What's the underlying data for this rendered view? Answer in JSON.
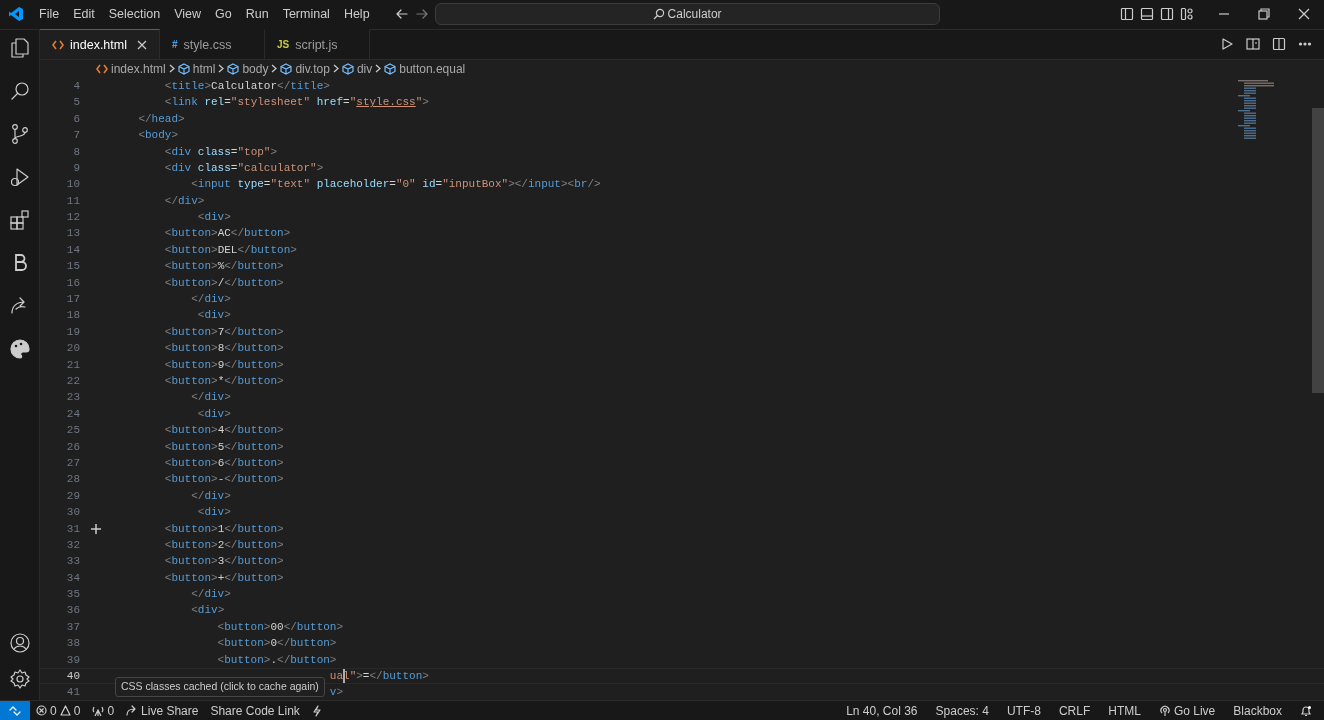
{
  "menu": [
    "File",
    "Edit",
    "Selection",
    "View",
    "Go",
    "Run",
    "Terminal",
    "Help"
  ],
  "command_center": {
    "text": "Calculator"
  },
  "tabs": [
    {
      "label": "index.html",
      "kind": "html",
      "selected": true
    },
    {
      "label": "style.css",
      "kind": "css",
      "badge": "#",
      "selected": false
    },
    {
      "label": "script.js",
      "kind": "js",
      "badge": "JS",
      "selected": false
    }
  ],
  "breadcrumbs": [
    {
      "label": "index.html",
      "kind": "file"
    },
    {
      "label": "html",
      "kind": "element"
    },
    {
      "label": "body",
      "kind": "element"
    },
    {
      "label": "div.top",
      "kind": "element"
    },
    {
      "label": "div",
      "kind": "element"
    },
    {
      "label": "button.equal",
      "kind": "element"
    }
  ],
  "code_lines": [
    {
      "number": "4",
      "current": false,
      "tokens": [
        {
          "kind": "punct",
          "text": "<"
        },
        {
          "kind": "tag",
          "text": "title"
        },
        {
          "kind": "punct",
          "text": ">"
        },
        {
          "kind": "text",
          "text": "Calculator"
        },
        {
          "kind": "punct",
          "text": "</"
        },
        {
          "kind": "tag",
          "text": "title"
        },
        {
          "kind": "punct",
          "text": ">"
        }
      ]
    },
    {
      "number": "5",
      "current": false,
      "tokens": [
        {
          "kind": "punct",
          "text": "<"
        },
        {
          "kind": "tag",
          "text": "link"
        },
        {
          "kind": "attr",
          "text": " rel"
        },
        {
          "kind": "text",
          "text": "="
        },
        {
          "kind": "string",
          "text": "\"stylesheet\""
        },
        {
          "kind": "attr",
          "text": " href"
        },
        {
          "kind": "text",
          "text": "="
        },
        {
          "kind": "string",
          "text": "\""
        },
        {
          "kind": "link",
          "text": "style.css"
        },
        {
          "kind": "string",
          "text": "\""
        },
        {
          "kind": "punct",
          "text": ">"
        }
      ]
    },
    {
      "number": "6",
      "current": false,
      "tokens": [
        {
          "kind": "punct",
          "text": "</"
        },
        {
          "kind": "tag",
          "text": "head"
        },
        {
          "kind": "punct",
          "text": ">"
        }
      ]
    },
    {
      "number": "7",
      "current": false,
      "tokens": [
        {
          "kind": "punct",
          "text": "<"
        },
        {
          "kind": "tag",
          "text": "body"
        },
        {
          "kind": "punct",
          "text": ">"
        }
      ]
    },
    {
      "number": "8",
      "current": false,
      "tokens": [
        {
          "kind": "punct",
          "text": "<"
        },
        {
          "kind": "tag",
          "text": "div"
        },
        {
          "kind": "attr",
          "text": " class"
        },
        {
          "kind": "text",
          "text": "="
        },
        {
          "kind": "string",
          "text": "\"top\""
        },
        {
          "kind": "punct",
          "text": ">"
        }
      ]
    },
    {
      "number": "9",
      "current": false,
      "tokens": [
        {
          "kind": "punct",
          "text": "<"
        },
        {
          "kind": "tag",
          "text": "div"
        },
        {
          "kind": "attr",
          "text": " class"
        },
        {
          "kind": "text",
          "text": "="
        },
        {
          "kind": "string",
          "text": "\"calculator\""
        },
        {
          "kind": "punct",
          "text": ">"
        }
      ]
    },
    {
      "number": "10",
      "current": false,
      "tokens": [
        {
          "kind": "punct",
          "text": "<"
        },
        {
          "kind": "tag",
          "text": "input"
        },
        {
          "kind": "attr",
          "text": " type"
        },
        {
          "kind": "text",
          "text": "="
        },
        {
          "kind": "string",
          "text": "\"text\""
        },
        {
          "kind": "attr",
          "text": " placeholder"
        },
        {
          "kind": "text",
          "text": "="
        },
        {
          "kind": "string",
          "text": "\"0\""
        },
        {
          "kind": "attr",
          "text": " id"
        },
        {
          "kind": "text",
          "text": "="
        },
        {
          "kind": "string",
          "text": "\"inputBox\""
        },
        {
          "kind": "punct",
          "text": "></"
        },
        {
          "kind": "tag",
          "text": "input"
        },
        {
          "kind": "punct",
          "text": "><"
        },
        {
          "kind": "tag",
          "text": "br"
        },
        {
          "kind": "punct",
          "text": "/>"
        }
      ]
    },
    {
      "number": "11",
      "current": false,
      "tokens": [
        {
          "kind": "punct",
          "text": "</"
        },
        {
          "kind": "tag",
          "text": "div"
        },
        {
          "kind": "punct",
          "text": ">"
        }
      ]
    },
    {
      "number": "12",
      "current": false,
      "tokens": [
        {
          "kind": "punct",
          "text": "<"
        },
        {
          "kind": "tag",
          "text": "div"
        },
        {
          "kind": "punct",
          "text": ">"
        }
      ]
    },
    {
      "number": "13",
      "current": false,
      "tokens": [
        {
          "kind": "punct",
          "text": "<"
        },
        {
          "kind": "tag",
          "text": "button"
        },
        {
          "kind": "punct",
          "text": ">"
        },
        {
          "kind": "text",
          "text": "AC"
        },
        {
          "kind": "punct",
          "text": "</"
        },
        {
          "kind": "tag",
          "text": "button"
        },
        {
          "kind": "punct",
          "text": ">"
        }
      ]
    },
    {
      "number": "14",
      "current": false,
      "tokens": [
        {
          "kind": "punct",
          "text": "<"
        },
        {
          "kind": "tag",
          "text": "button"
        },
        {
          "kind": "punct",
          "text": ">"
        },
        {
          "kind": "text",
          "text": "DEL"
        },
        {
          "kind": "punct",
          "text": "</"
        },
        {
          "kind": "tag",
          "text": "button"
        },
        {
          "kind": "punct",
          "text": ">"
        }
      ]
    },
    {
      "number": "15",
      "current": false,
      "tokens": [
        {
          "kind": "punct",
          "text": "<"
        },
        {
          "kind": "tag",
          "text": "button"
        },
        {
          "kind": "punct",
          "text": ">"
        },
        {
          "kind": "text",
          "text": "%"
        },
        {
          "kind": "punct",
          "text": "</"
        },
        {
          "kind": "tag",
          "text": "button"
        },
        {
          "kind": "punct",
          "text": ">"
        }
      ]
    },
    {
      "number": "16",
      "current": false,
      "tokens": [
        {
          "kind": "punct",
          "text": "<"
        },
        {
          "kind": "tag",
          "text": "button"
        },
        {
          "kind": "punct",
          "text": ">"
        },
        {
          "kind": "text",
          "text": "/"
        },
        {
          "kind": "punct",
          "text": "</"
        },
        {
          "kind": "tag",
          "text": "button"
        },
        {
          "kind": "punct",
          "text": ">"
        }
      ]
    },
    {
      "number": "17",
      "current": false,
      "tokens": [
        {
          "kind": "punct",
          "text": "</"
        },
        {
          "kind": "tag",
          "text": "div"
        },
        {
          "kind": "punct",
          "text": ">"
        }
      ]
    },
    {
      "number": "18",
      "current": false,
      "tokens": [
        {
          "kind": "punct",
          "text": "<"
        },
        {
          "kind": "tag",
          "text": "div"
        },
        {
          "kind": "punct",
          "text": ">"
        }
      ]
    },
    {
      "number": "19",
      "current": false,
      "tokens": [
        {
          "kind": "punct",
          "text": "<"
        },
        {
          "kind": "tag",
          "text": "button"
        },
        {
          "kind": "punct",
          "text": ">"
        },
        {
          "kind": "text",
          "text": "7"
        },
        {
          "kind": "punct",
          "text": "</"
        },
        {
          "kind": "tag",
          "text": "button"
        },
        {
          "kind": "punct",
          "text": ">"
        }
      ]
    },
    {
      "number": "20",
      "current": false,
      "tokens": [
        {
          "kind": "punct",
          "text": "<"
        },
        {
          "kind": "tag",
          "text": "button"
        },
        {
          "kind": "punct",
          "text": ">"
        },
        {
          "kind": "text",
          "text": "8"
        },
        {
          "kind": "punct",
          "text": "</"
        },
        {
          "kind": "tag",
          "text": "button"
        },
        {
          "kind": "punct",
          "text": ">"
        }
      ]
    },
    {
      "number": "21",
      "current": false,
      "tokens": [
        {
          "kind": "punct",
          "text": "<"
        },
        {
          "kind": "tag",
          "text": "button"
        },
        {
          "kind": "punct",
          "text": ">"
        },
        {
          "kind": "text",
          "text": "9"
        },
        {
          "kind": "punct",
          "text": "</"
        },
        {
          "kind": "tag",
          "text": "button"
        },
        {
          "kind": "punct",
          "text": ">"
        }
      ]
    },
    {
      "number": "22",
      "current": false,
      "tokens": [
        {
          "kind": "punct",
          "text": "<"
        },
        {
          "kind": "tag",
          "text": "button"
        },
        {
          "kind": "punct",
          "text": ">"
        },
        {
          "kind": "text",
          "text": "*"
        },
        {
          "kind": "punct",
          "text": "</"
        },
        {
          "kind": "tag",
          "text": "button"
        },
        {
          "kind": "punct",
          "text": ">"
        }
      ]
    },
    {
      "number": "23",
      "current": false,
      "tokens": [
        {
          "kind": "punct",
          "text": "</"
        },
        {
          "kind": "tag",
          "text": "div"
        },
        {
          "kind": "punct",
          "text": ">"
        }
      ]
    },
    {
      "number": "24",
      "current": false,
      "tokens": [
        {
          "kind": "punct",
          "text": "<"
        },
        {
          "kind": "tag",
          "text": "div"
        },
        {
          "kind": "punct",
          "text": ">"
        }
      ]
    },
    {
      "number": "25",
      "current": false,
      "tokens": [
        {
          "kind": "punct",
          "text": "<"
        },
        {
          "kind": "tag",
          "text": "button"
        },
        {
          "kind": "punct",
          "text": ">"
        },
        {
          "kind": "text",
          "text": "4"
        },
        {
          "kind": "punct",
          "text": "</"
        },
        {
          "kind": "tag",
          "text": "button"
        },
        {
          "kind": "punct",
          "text": ">"
        }
      ]
    },
    {
      "number": "26",
      "current": false,
      "tokens": [
        {
          "kind": "punct",
          "text": "<"
        },
        {
          "kind": "tag",
          "text": "button"
        },
        {
          "kind": "punct",
          "text": ">"
        },
        {
          "kind": "text",
          "text": "5"
        },
        {
          "kind": "punct",
          "text": "</"
        },
        {
          "kind": "tag",
          "text": "button"
        },
        {
          "kind": "punct",
          "text": ">"
        }
      ]
    },
    {
      "number": "27",
      "current": false,
      "tokens": [
        {
          "kind": "punct",
          "text": "<"
        },
        {
          "kind": "tag",
          "text": "button"
        },
        {
          "kind": "punct",
          "text": ">"
        },
        {
          "kind": "text",
          "text": "6"
        },
        {
          "kind": "punct",
          "text": "</"
        },
        {
          "kind": "tag",
          "text": "button"
        },
        {
          "kind": "punct",
          "text": ">"
        }
      ]
    },
    {
      "number": "28",
      "current": false,
      "tokens": [
        {
          "kind": "punct",
          "text": "<"
        },
        {
          "kind": "tag",
          "text": "button"
        },
        {
          "kind": "punct",
          "text": ">"
        },
        {
          "kind": "text",
          "text": "-"
        },
        {
          "kind": "punct",
          "text": "</"
        },
        {
          "kind": "tag",
          "text": "button"
        },
        {
          "kind": "punct",
          "text": ">"
        }
      ]
    },
    {
      "number": "29",
      "current": false,
      "tokens": [
        {
          "kind": "punct",
          "text": "</"
        },
        {
          "kind": "tag",
          "text": "div"
        },
        {
          "kind": "punct",
          "text": ">"
        }
      ]
    },
    {
      "number": "30",
      "current": false,
      "tokens": [
        {
          "kind": "punct",
          "text": "<"
        },
        {
          "kind": "tag",
          "text": "div"
        },
        {
          "kind": "punct",
          "text": ">"
        }
      ]
    },
    {
      "number": "31",
      "current": false,
      "gutter_icon": true,
      "tokens": [
        {
          "kind": "punct",
          "text": "<"
        },
        {
          "kind": "tag",
          "text": "button"
        },
        {
          "kind": "punct",
          "text": ">"
        },
        {
          "kind": "text",
          "text": "1"
        },
        {
          "kind": "punct",
          "text": "</"
        },
        {
          "kind": "tag",
          "text": "button"
        },
        {
          "kind": "punct",
          "text": ">"
        }
      ]
    },
    {
      "number": "32",
      "current": false,
      "tokens": [
        {
          "kind": "punct",
          "text": "<"
        },
        {
          "kind": "tag",
          "text": "button"
        },
        {
          "kind": "punct",
          "text": ">"
        },
        {
          "kind": "text",
          "text": "2"
        },
        {
          "kind": "punct",
          "text": "</"
        },
        {
          "kind": "tag",
          "text": "button"
        },
        {
          "kind": "punct",
          "text": ">"
        }
      ]
    },
    {
      "number": "33",
      "current": false,
      "tokens": [
        {
          "kind": "punct",
          "text": "<"
        },
        {
          "kind": "tag",
          "text": "button"
        },
        {
          "kind": "punct",
          "text": ">"
        },
        {
          "kind": "text",
          "text": "3"
        },
        {
          "kind": "punct",
          "text": "</"
        },
        {
          "kind": "tag",
          "text": "button"
        },
        {
          "kind": "punct",
          "text": ">"
        }
      ]
    },
    {
      "number": "34",
      "current": false,
      "tokens": [
        {
          "kind": "punct",
          "text": "<"
        },
        {
          "kind": "tag",
          "text": "button"
        },
        {
          "kind": "punct",
          "text": ">"
        },
        {
          "kind": "text",
          "text": "+"
        },
        {
          "kind": "punct",
          "text": "</"
        },
        {
          "kind": "tag",
          "text": "button"
        },
        {
          "kind": "punct",
          "text": ">"
        }
      ]
    },
    {
      "number": "35",
      "current": false,
      "tokens": [
        {
          "kind": "punct",
          "text": "</"
        },
        {
          "kind": "tag",
          "text": "div"
        },
        {
          "kind": "punct",
          "text": ">"
        }
      ]
    },
    {
      "number": "36",
      "current": false,
      "tokens": [
        {
          "kind": "punct",
          "text": "<"
        },
        {
          "kind": "tag",
          "text": "div"
        },
        {
          "kind": "punct",
          "text": ">"
        }
      ]
    },
    {
      "number": "37",
      "current": false,
      "tokens": [
        {
          "kind": "punct",
          "text": "<"
        },
        {
          "kind": "tag",
          "text": "button"
        },
        {
          "kind": "punct",
          "text": ">"
        },
        {
          "kind": "text",
          "text": "00"
        },
        {
          "kind": "punct",
          "text": "</"
        },
        {
          "kind": "tag",
          "text": "button"
        },
        {
          "kind": "punct",
          "text": ">"
        }
      ]
    },
    {
      "number": "38",
      "current": false,
      "tokens": [
        {
          "kind": "punct",
          "text": "<"
        },
        {
          "kind": "tag",
          "text": "button"
        },
        {
          "kind": "punct",
          "text": ">"
        },
        {
          "kind": "text",
          "text": "0"
        },
        {
          "kind": "punct",
          "text": "</"
        },
        {
          "kind": "tag",
          "text": "button"
        },
        {
          "kind": "punct",
          "text": ">"
        }
      ]
    },
    {
      "number": "39",
      "current": false,
      "tokens": [
        {
          "kind": "punct",
          "text": "<"
        },
        {
          "kind": "tag",
          "text": "button"
        },
        {
          "kind": "punct",
          "text": ">"
        },
        {
          "kind": "text",
          "text": "."
        },
        {
          "kind": "punct",
          "text": "</"
        },
        {
          "kind": "tag",
          "text": "button"
        },
        {
          "kind": "punct",
          "text": ">"
        }
      ]
    },
    {
      "number": "40",
      "current": true,
      "tokens": [
        {
          "kind": "string",
          "text": "ual\""
        },
        {
          "kind": "punct",
          "text": ">"
        },
        {
          "kind": "text",
          "text": "="
        },
        {
          "kind": "punct",
          "text": "</"
        },
        {
          "kind": "tag",
          "text": "button"
        },
        {
          "kind": "punct",
          "text": ">"
        }
      ]
    },
    {
      "number": "41",
      "current": false,
      "tokens": [
        {
          "kind": "tag",
          "text": "v"
        },
        {
          "kind": "punct",
          "text": ">"
        }
      ]
    }
  ],
  "tooltip": "CSS classes cached (click to cache again)",
  "status_left": [
    {
      "kind": "remote"
    },
    {
      "kind": "problems",
      "errors": "0",
      "warnings": "0"
    },
    {
      "kind": "ports",
      "text": "0"
    },
    {
      "kind": "liveshare",
      "text": "Live Share"
    },
    {
      "kind": "text",
      "text": "Share Code Link"
    },
    {
      "kind": "bolt"
    }
  ],
  "status_right": [
    {
      "kind": "text",
      "text": "Ln 40, Col 36"
    },
    {
      "kind": "text",
      "text": "Spaces: 4"
    },
    {
      "kind": "text",
      "text": "UTF-8"
    },
    {
      "kind": "text",
      "text": "CRLF"
    },
    {
      "kind": "text",
      "text": "HTML"
    },
    {
      "kind": "golive",
      "text": "Go Live"
    },
    {
      "kind": "text",
      "text": "Blackbox"
    },
    {
      "kind": "bell"
    }
  ]
}
